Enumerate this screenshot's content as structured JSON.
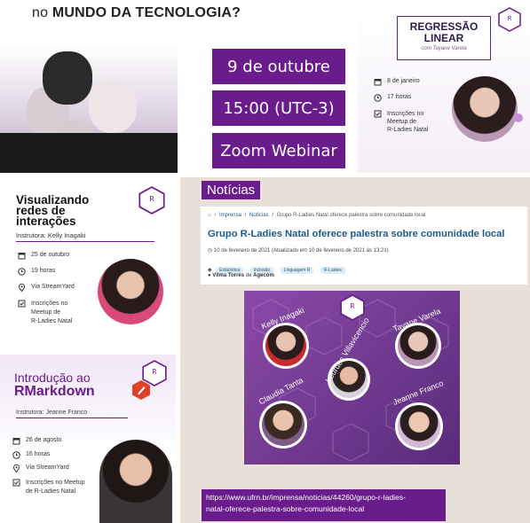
{
  "top_left": {
    "question_prefix": "no ",
    "question_bold": "MUNDO DA TECNOLOGIA?",
    "date": "9 de outubre",
    "time": "15:00 (UTC-3)",
    "platform": "Zoom Webinar"
  },
  "regressao": {
    "title_line1": "REGRESSÃO",
    "title_line2": "LINEAR",
    "subtitle": "com Tayane Varela",
    "logo_text": "R Ladies",
    "date": "8 de janeiro",
    "time": "17 horas",
    "where_l1": "Inscrições no",
    "where_l2": "Meetup de",
    "where_l3": "R-Ladies Natal"
  },
  "visualizando": {
    "title_l1": "Visualizando",
    "title_l2": "redes de",
    "title_l3": "interações",
    "instructor": "Instrutora: Kelly Inagaki",
    "date": "25 de outubro",
    "time": "19 horas",
    "where": "Via StreamYard",
    "sign_l1": "Inscrições no",
    "sign_l2": "Meetup de",
    "sign_l3": "R-Ladies Natal"
  },
  "rmarkdown": {
    "title_l1": "Introdução ao",
    "title_l2": "RMarkdown",
    "instructor": "Instrutora: Jeanne Franco",
    "date": "26 de agosto",
    "time": "16 horas",
    "where": "Via StreamYard",
    "sign_l1": "Inscrições no Meetup",
    "sign_l2": "de R-Ladies Natal"
  },
  "noticias": {
    "header": "Notícias",
    "breadcrumb": [
      "Imprensa",
      "Notícias",
      "Grupo R-Ladies Natal oferece palestra sobre comunidade local"
    ],
    "headline": "Grupo R-Ladies Natal oferece palestra sobre comunidade local",
    "date_line": "10 de fevereiro de 2021 (Atualizado em 10 de fevereiro de 2021 às 13:21)",
    "tags": [
      "Estatística",
      "Inclusão",
      "Linguagem R",
      "R-Ladies"
    ],
    "author": "Vilma Torres",
    "author_of": "de",
    "agency": "Agecom",
    "speakers": [
      "Kelly Inagaki",
      "Tayane Varela",
      "Lourdes Villavicencio",
      "Claudia Tanta",
      "Jeanne Franco"
    ],
    "url_l1": "https://www.ufrn.br/imprensa/noticias/44260/grupo-r-ladies-",
    "url_l2": "natal-oferece-palestra-sobre-comunidade-local"
  },
  "colors": {
    "purple": "#6a1b8c",
    "accent": "#e0402a"
  }
}
